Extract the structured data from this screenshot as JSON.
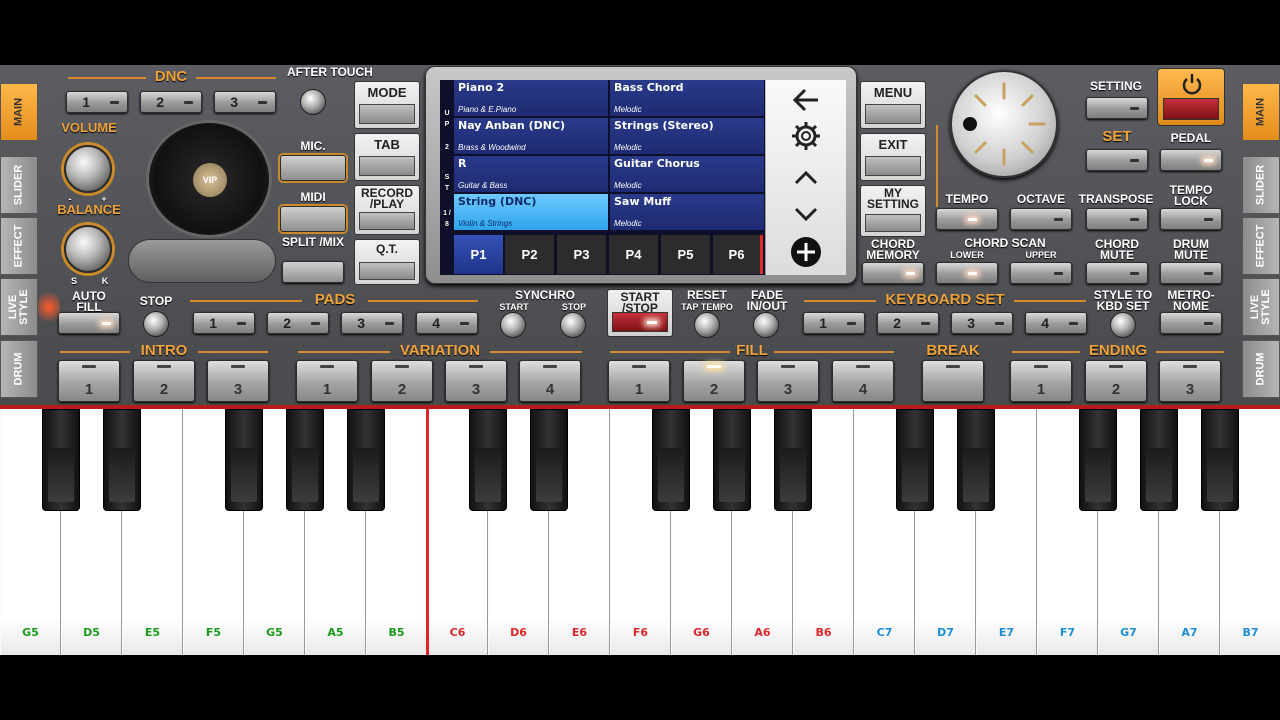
{
  "left_tabs": [
    "MAIN",
    "SLIDER",
    "EFFECT",
    "LIVE STYLE",
    "DRUM"
  ],
  "right_tabs": [
    "MAIN",
    "SLIDER",
    "EFFECT",
    "LIVE STYLE",
    "DRUM"
  ],
  "dnc": {
    "label": "DNC",
    "buttons": [
      "1",
      "2",
      "3"
    ]
  },
  "after_touch": "AFTER TOUCH",
  "volume": "VOLUME",
  "balance": "BALANCE",
  "balance_scale": {
    "minus": "-",
    "plus": "+",
    "left": "S",
    "right": "K"
  },
  "vip": "VIP",
  "mic": "MIC.",
  "midi": "MIDI",
  "split_mix": "SPLIT /MIX",
  "mode_buttons": [
    "MODE",
    "TAB",
    "RECORD /PLAY",
    "Q.T."
  ],
  "voices": {
    "row_labels": [
      "U P",
      "2",
      "S T",
      "1 / 8"
    ],
    "cells": [
      {
        "name": "Piano 2",
        "category": "Piano & E.Piano"
      },
      {
        "name": "Bass Chord",
        "category": "Melodic"
      },
      {
        "name": "Nay Anban (DNC)",
        "category": "Brass & Woodwind"
      },
      {
        "name": "Strings (Stereo)",
        "category": "Melodic"
      },
      {
        "name": "R",
        "category": "Guitar & Bass"
      },
      {
        "name": "Guitar Chorus",
        "category": "Melodic"
      },
      {
        "name": "String (DNC)",
        "category": "Violin & Strings"
      },
      {
        "name": "Saw Muff",
        "category": "Melodic"
      }
    ],
    "pages": [
      "P1",
      "P2",
      "P3",
      "P4",
      "P5",
      "P6"
    ]
  },
  "right_menu": [
    "MENU",
    "EXIT",
    "MY SETTING",
    "CHORD MEMORY"
  ],
  "setting": "SETTING",
  "set": "SET",
  "pedal": "PEDAL",
  "tempo_row": [
    "TEMPO",
    "OCTAVE",
    "TRANSPOSE",
    "TEMPO LOCK"
  ],
  "chord_scan": {
    "title": "CHORD SCAN",
    "lower": "LOWER",
    "upper": "UPPER"
  },
  "chord_mute": "CHORD MUTE",
  "drum_mute": "DRUM MUTE",
  "auto_fill": "AUTO FILL",
  "stop": "STOP",
  "pads": {
    "label": "PADS",
    "buttons": [
      "1",
      "2",
      "3",
      "4"
    ]
  },
  "synchro": {
    "title": "SYNCHRO",
    "start": "START",
    "stop": "STOP"
  },
  "start_stop": "START /STOP",
  "reset": {
    "title": "RESET",
    "sub": "TAP TEMPO"
  },
  "fade": "FADE IN/OUT",
  "keyboard_set": {
    "label": "KEYBOARD SET",
    "buttons": [
      "1",
      "2",
      "3",
      "4"
    ]
  },
  "style_to_kbd": "STYLE TO KBD SET",
  "metronome": "METRO- NOME",
  "sections": [
    {
      "label": "INTRO",
      "buttons": [
        "1",
        "2",
        "3"
      ]
    },
    {
      "label": "VARIATION",
      "buttons": [
        "1",
        "2",
        "3",
        "4"
      ]
    },
    {
      "label": "FILL",
      "buttons": [
        "1",
        "2",
        "3",
        "4"
      ]
    },
    {
      "label": "BREAK",
      "buttons": [
        ""
      ]
    },
    {
      "label": "ENDING",
      "buttons": [
        "1",
        "2",
        "3"
      ]
    }
  ],
  "keys": [
    "G5",
    "D5",
    "E5",
    "F5",
    "G5",
    "A5",
    "B5",
    "C6",
    "D6",
    "E6",
    "F6",
    "G6",
    "A6",
    "B6",
    "C7",
    "D7",
    "E7",
    "F7",
    "G7",
    "A7",
    "B7"
  ],
  "colors": {
    "accent": "#f0a33a",
    "octave5": "#1a9a1a",
    "octave6": "#e0252a",
    "octave7": "#1a8ed8",
    "selected_voice": "#3fb4f5"
  }
}
